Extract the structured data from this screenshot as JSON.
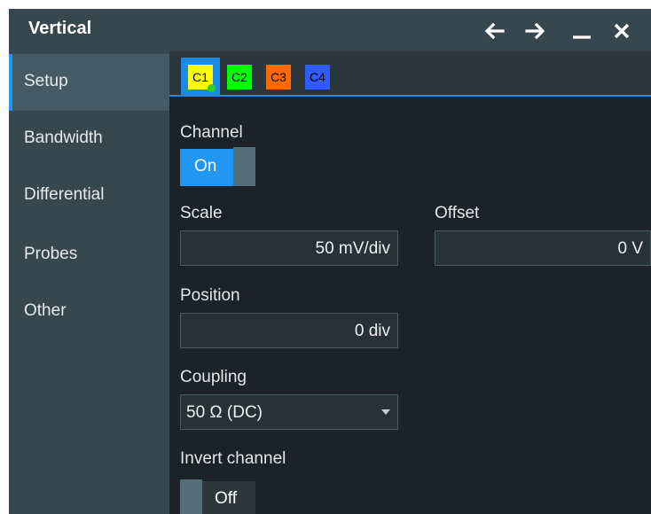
{
  "window": {
    "title": "Vertical"
  },
  "titlebar_buttons": [
    {
      "name": "back-arrow-icon"
    },
    {
      "name": "forward-arrow-icon"
    },
    {
      "name": "minimize-icon"
    },
    {
      "name": "close-icon"
    }
  ],
  "sidebar": {
    "items": [
      {
        "label": "Setup",
        "active": true
      },
      {
        "label": "Bandwidth"
      },
      {
        "label": "Differential"
      },
      {
        "label": "Probes"
      },
      {
        "label": "Other"
      }
    ]
  },
  "tabs": [
    {
      "label": "C1",
      "color": "#ffff00",
      "active": true
    },
    {
      "label": "C2",
      "color": "#00ff00"
    },
    {
      "label": "C3",
      "color": "#ff6a00"
    },
    {
      "label": "C4",
      "color": "#2f5bff"
    }
  ],
  "channel": {
    "label": "Channel",
    "toggle_label": "On",
    "state": "on"
  },
  "scale": {
    "label": "Scale",
    "value": "50 mV/div"
  },
  "offset": {
    "label": "Offset",
    "value": "0 V"
  },
  "position": {
    "label": "Position",
    "value": "0 div"
  },
  "coupling": {
    "label": "Coupling",
    "value": "50 Ω (DC)"
  },
  "invert": {
    "label": "Invert channel",
    "toggle_label": "Off",
    "state": "off"
  },
  "colors": {
    "accent": "#2196f3",
    "sidebar": "#37474f",
    "panel": "#1b2329"
  }
}
